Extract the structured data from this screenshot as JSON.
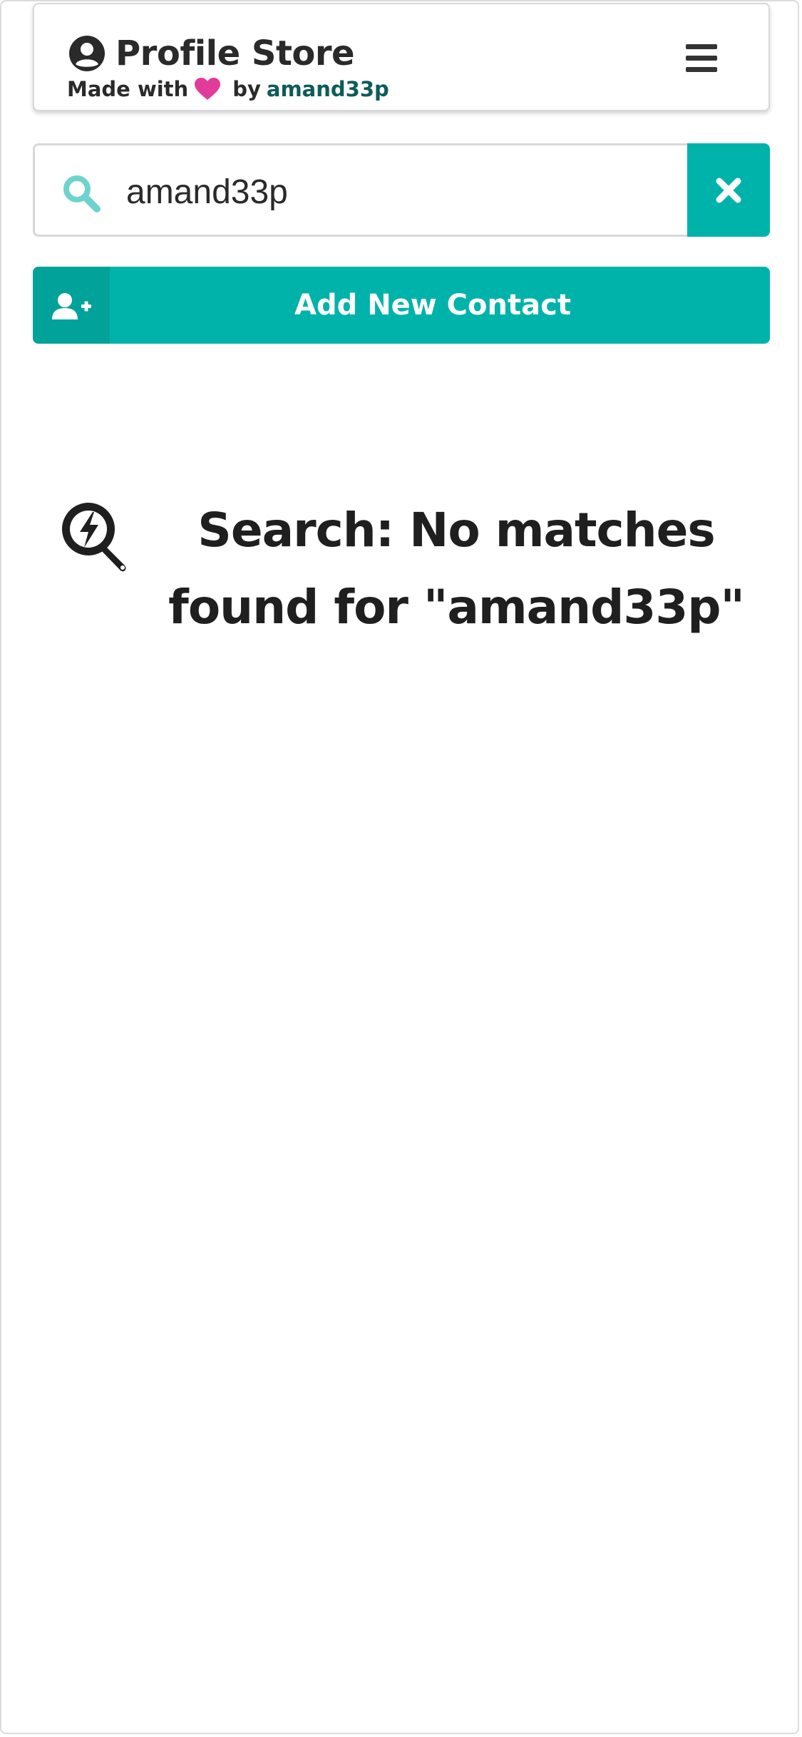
{
  "header": {
    "title": "Profile Store",
    "made_with": "Made with",
    "by": "by",
    "author": "amand33p",
    "icons": {
      "brand": "user-circle-icon",
      "heart": "heart-icon",
      "menu": "hamburger-menu-icon"
    },
    "heart_color": "#e23c9a"
  },
  "search": {
    "value": "amand33p",
    "placeholder": "",
    "icon": "search-icon",
    "clear_icon": "close-icon"
  },
  "add_contact": {
    "label": "Add New Contact",
    "icon": "user-plus-icon"
  },
  "empty_state": {
    "icon": "search-no-result-icon",
    "message": "Search: No matches found for \"amand33p\""
  },
  "colors": {
    "accent": "#00b3aa",
    "accent_dark": "#01a29a",
    "search_icon": "#6fd3cd",
    "link": "#0d5c5a"
  }
}
